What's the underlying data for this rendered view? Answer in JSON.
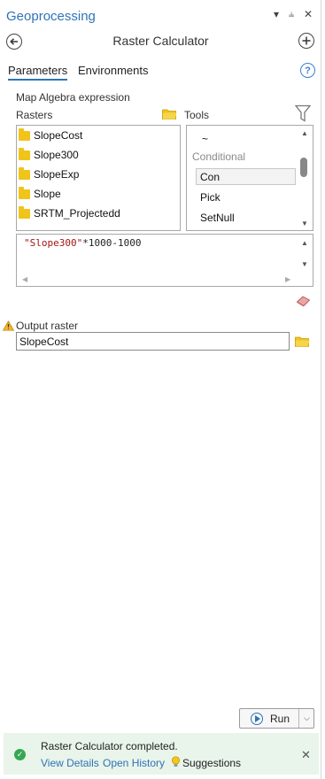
{
  "pane": {
    "title": "Geoprocessing",
    "tool_title": "Raster Calculator",
    "controls": {
      "menu": "▾",
      "pin": "⫨",
      "close": "✕"
    }
  },
  "tabs": [
    {
      "label": "Parameters",
      "active": true
    },
    {
      "label": "Environments",
      "active": false
    }
  ],
  "section": {
    "expression_label": "Map Algebra expression",
    "rasters_label": "Rasters",
    "tools_label": "Tools"
  },
  "rasters": [
    "SlopeCost",
    "Slope300",
    "SlopeExp",
    "Slope",
    "SRTM_Projectedd"
  ],
  "tools": {
    "items": [
      "~",
      "Conditional",
      "Con",
      "Pick",
      "SetNull"
    ],
    "selected": "Con"
  },
  "expression": {
    "quoted": "\"Slope300\"",
    "rest": "*1000-1000"
  },
  "output": {
    "label": "Output raster",
    "value": "SlopeCost"
  },
  "run": {
    "label": "Run"
  },
  "status": {
    "message": "Raster Calculator completed.",
    "view_details": "View Details",
    "open_history": "Open History",
    "suggestions": "Suggestions"
  },
  "colors": {
    "accent": "#2f73b8",
    "folder": "#f0c419",
    "success": "#36a852",
    "status_bg": "#e9f4ea"
  }
}
